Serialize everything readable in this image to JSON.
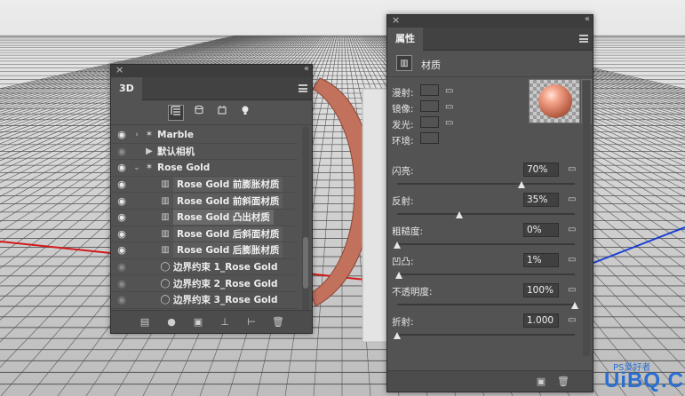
{
  "panel_3d": {
    "close_glyph": "×",
    "collapse_glyph": "‹‹",
    "tab_label": "3D",
    "filters": [
      {
        "icon": "scene-icon",
        "active": true
      },
      {
        "icon": "mesh-icon"
      },
      {
        "icon": "material-icon"
      },
      {
        "icon": "light-icon"
      }
    ],
    "rows": [
      {
        "label": "Marble",
        "icon": "star-icon",
        "visible": true,
        "caret": "›"
      },
      {
        "label": "默认相机",
        "icon": "camera-icon",
        "visible": false
      },
      {
        "label": "Rose Gold",
        "icon": "star-icon",
        "visible": true,
        "caret": "⌄"
      },
      {
        "label": "Rose Gold 前膨胀材质",
        "icon": "material-icon",
        "visible": true
      },
      {
        "label": "Rose Gold 前斜面材质",
        "icon": "material-icon",
        "visible": true
      },
      {
        "label": "Rose Gold 凸出材质",
        "icon": "material-icon",
        "visible": true,
        "selected": true
      },
      {
        "label": "Rose Gold 后斜面材质",
        "icon": "material-icon",
        "visible": true
      },
      {
        "label": "Rose Gold 后膨胀材质",
        "icon": "material-icon",
        "visible": true
      },
      {
        "label": "边界约束 1_Rose Gold",
        "icon": "circle-icon",
        "visible": false
      },
      {
        "label": "边界约束 2_Rose Gold",
        "icon": "circle-icon",
        "visible": false
      },
      {
        "label": "边界约束 3_Rose Gold",
        "icon": "circle-icon",
        "visible": false
      }
    ],
    "bottom_icons": [
      "material-drop-icon",
      "light-add-icon",
      "render-icon",
      "constraint-icon",
      "new-object-icon",
      "trash-icon"
    ]
  },
  "panel_props": {
    "close_glyph": "×",
    "collapse_glyph": "‹‹",
    "tab_label": "属性",
    "header_title": "材质",
    "swatches": [
      {
        "label": "漫射:",
        "color": "#f07a52"
      },
      {
        "label": "镜像:",
        "color": "#d9978a"
      },
      {
        "label": "发光:",
        "color": "#000000"
      },
      {
        "label": "环境:",
        "color": "#000000"
      }
    ],
    "properties": [
      {
        "label": "闪亮:",
        "value": "70%",
        "fraction": 0.7
      },
      {
        "label": "反射:",
        "value": "35%",
        "fraction": 0.35
      },
      {
        "label": "粗糙度:",
        "value": "0%",
        "fraction": 0.0
      },
      {
        "label": "凹凸:",
        "value": "1%",
        "fraction": 0.01
      },
      {
        "label": "不透明度:",
        "value": "100%",
        "fraction": 1.0
      },
      {
        "label": "折射:",
        "value": "1.000",
        "fraction": 0.0
      }
    ]
  },
  "watermark": {
    "text": "UiBQ.CoM",
    "small_text": "PS爱好者"
  }
}
